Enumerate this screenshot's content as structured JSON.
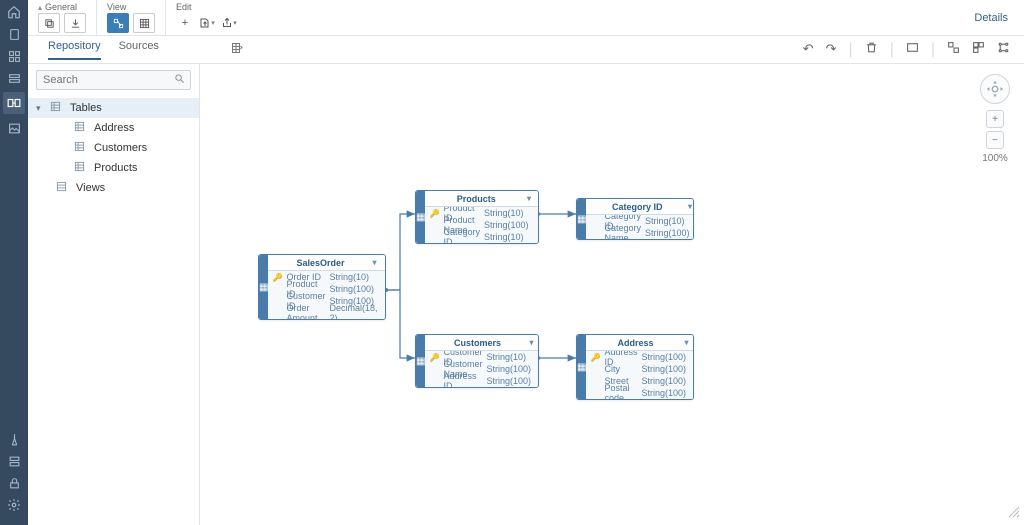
{
  "toolbar": {
    "group_general": "General",
    "group_view": "View",
    "group_edit": "Edit",
    "details": "Details"
  },
  "tabs": {
    "repository": "Repository",
    "sources": "Sources"
  },
  "search": {
    "placeholder": "Search"
  },
  "tree": {
    "tables": "Tables",
    "address": "Address",
    "customers": "Customers",
    "products": "Products",
    "views": "Views"
  },
  "zoom": {
    "pct": "100%",
    "plus": "+",
    "minus": "−"
  },
  "nodes": {
    "salesorder": {
      "title": "SalesOrder",
      "r0c1": "Order ID",
      "r0c2": "String(10)",
      "r1c1": "Product ID",
      "r1c2": "String(100)",
      "r2c1": "Customer ID",
      "r2c2": "String(100)",
      "r3c1": "Order Amount",
      "r3c2": "Decimal(18, 2)"
    },
    "products": {
      "title": "Products",
      "r0c1": "Product ID",
      "r0c2": "String(10)",
      "r1c1": "Product Name",
      "r1c2": "String(100)",
      "r2c1": "Category ID",
      "r2c2": "String(10)"
    },
    "category": {
      "title": "Category ID",
      "r0c1": "Category ID",
      "r0c2": "String(10)",
      "r1c1": "Category Name",
      "r1c2": "String(100)"
    },
    "customers": {
      "title": "Customers",
      "r0c1": "Customer ID",
      "r0c2": "String(10)",
      "r1c1": "Customer Name",
      "r1c2": "String(100)",
      "r2c1": "Address ID",
      "r2c2": "String(100)"
    },
    "address": {
      "title": "Address",
      "r0c1": "Address ID",
      "r0c2": "String(100)",
      "r1c1": "City",
      "r1c2": "String(100)",
      "r2c1": "Street",
      "r2c2": "String(100)",
      "r3c1": "Postal code",
      "r3c2": "String(100)"
    }
  }
}
